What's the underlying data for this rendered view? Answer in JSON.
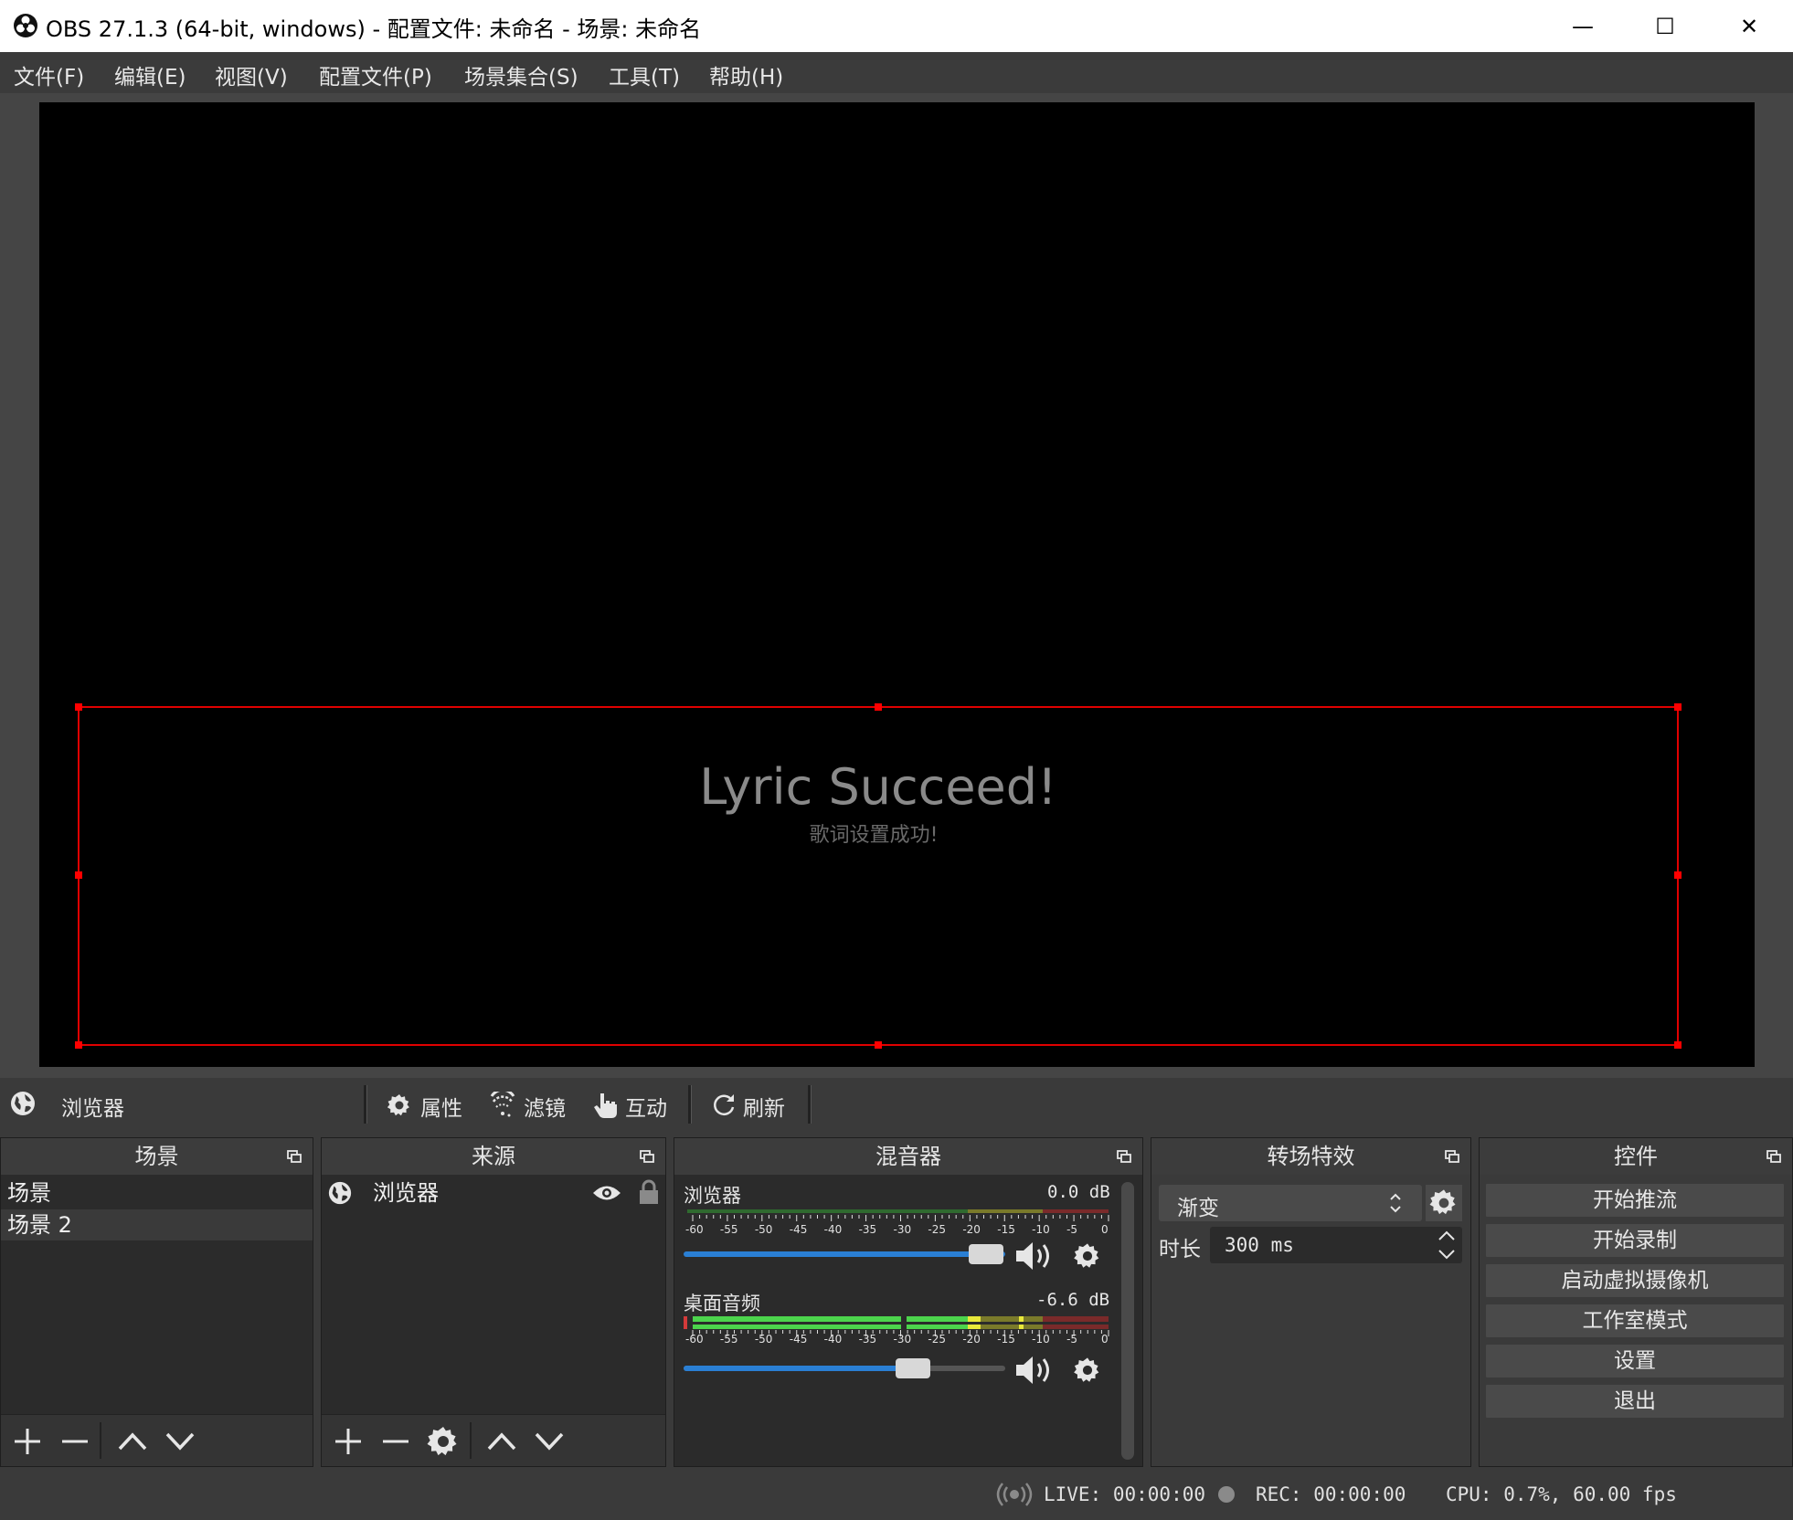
{
  "window": {
    "title": "OBS 27.1.3 (64-bit, windows) - 配置文件: 未命名 - 场景: 未命名",
    "minimize": "—",
    "maximize": "☐",
    "close": "✕"
  },
  "menu": [
    "文件(F)",
    "编辑(E)",
    "视图(V)",
    "配置文件(P)",
    "场景集合(S)",
    "工具(T)",
    "帮助(H)"
  ],
  "preview": {
    "lyric_main": "Lyric Succeed!",
    "lyric_sub": "歌词设置成功!",
    "selection_color": "#e00000"
  },
  "source_toolbar": {
    "source_name": "浏览器",
    "properties": "属性",
    "filters": "滤镜",
    "interact": "互动",
    "refresh": "刷新"
  },
  "scenes": {
    "title": "场景",
    "items": [
      "场景",
      "场景 2"
    ],
    "selected_index": 1
  },
  "sources": {
    "title": "来源",
    "items": [
      {
        "name": "浏览器",
        "visible": true,
        "locked": true
      }
    ]
  },
  "mixer": {
    "title": "混音器",
    "ticks": [
      "-60",
      "-55",
      "-50",
      "-45",
      "-40",
      "-35",
      "-30",
      "-25",
      "-20",
      "-15",
      "-10",
      "-5",
      "0"
    ],
    "channels": [
      {
        "name": "浏览器",
        "db": "0.0 dB",
        "volume": 0.95
      },
      {
        "name": "桌面音频",
        "db": "-6.6 dB",
        "volume": 0.71
      }
    ]
  },
  "transitions": {
    "title": "转场特效",
    "selected": "渐变",
    "duration_label": "时长",
    "duration_value": "300 ms"
  },
  "controls": {
    "title": "控件",
    "buttons": [
      "开始推流",
      "开始录制",
      "启动虚拟摄像机",
      "工作室模式",
      "设置",
      "退出"
    ]
  },
  "status": {
    "live": "LIVE: 00:00:00",
    "rec": "REC: 00:00:00",
    "cpu": "CPU: 0.7%, 60.00 fps"
  },
  "colors": {
    "meter_green": "#4cd44c",
    "meter_yellow": "#e8e83a",
    "meter_red": "#d43a3a",
    "slider_blue": "#2a7fd4"
  }
}
